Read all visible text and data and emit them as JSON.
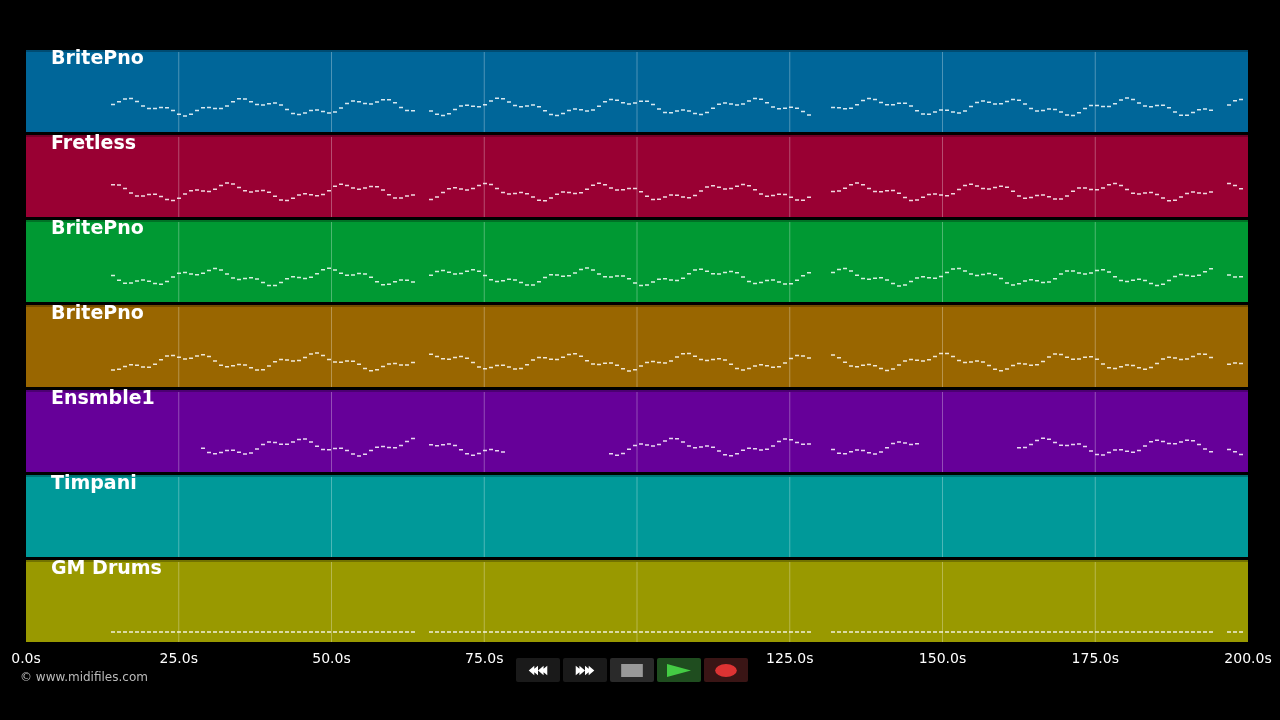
{
  "tracks": [
    {
      "name": "BritePno",
      "color": "#006699"
    },
    {
      "name": "Fretless",
      "color": "#990033"
    },
    {
      "name": "BritePno",
      "color": "#009933"
    },
    {
      "name": "BritePno",
      "color": "#996600"
    },
    {
      "name": "Ensmble1",
      "color": "#660099"
    },
    {
      "name": "Timpani",
      "color": "#009999"
    },
    {
      "name": "GM Drums",
      "color": "#999900"
    }
  ],
  "time_axis": {
    "ticks": [
      "0.0s",
      "25.0s",
      "50.0s",
      "75.0s",
      "125.0s",
      "150.0s",
      "175.0s",
      "200.0s"
    ]
  },
  "credit": "© www.midifiles.com",
  "transport": [
    {
      "kind": "rewind"
    },
    {
      "kind": "forward"
    },
    {
      "kind": "stop"
    },
    {
      "kind": "play"
    },
    {
      "kind": "record"
    }
  ]
}
